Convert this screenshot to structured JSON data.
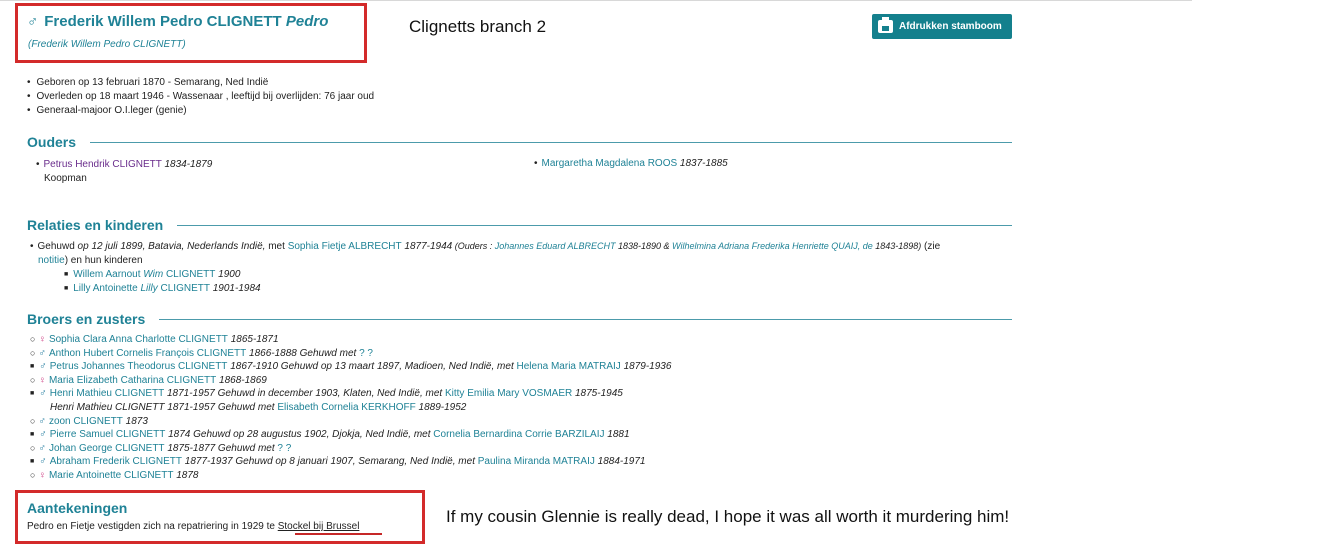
{
  "person": {
    "symbol": "♂",
    "name": "Frederik Willem Pedro CLIGNETT",
    "nickname": "Pedro",
    "alt_name": "(Frederik Willem Pedro CLIGNETT)"
  },
  "annotation_title": "Clignetts branch 2",
  "print_button_label": "Afdrukken stamboom",
  "facts": [
    "Geboren op 13 februari 1870 - Semarang, Ned Indië",
    "Overleden op 18 maart 1946 - Wassenaar , leeftijd bij overlijden: 76 jaar oud",
    "Generaal-majoor O.I.leger (genie)"
  ],
  "sections": {
    "parents": "Ouders",
    "relations": "Relaties en kinderen",
    "siblings": "Broers en zusters",
    "notes": "Aantekeningen"
  },
  "parents": {
    "father": {
      "name": "Petrus Hendrik CLIGNETT",
      "years": "1834-1879",
      "occupation": "Koopman"
    },
    "mother": {
      "name": "Margaretha Magdalena ROOS",
      "years": "1837-1885"
    }
  },
  "relation": {
    "prefix": "Gehuwd",
    "detail": " op 12 juli 1899, Batavia, Nederlands Indië,",
    "met": " met ",
    "spouse": "Sophia Fietje ALBRECHT",
    "spouse_years": " 1877-1944",
    "ouders_label": " (Ouders : ",
    "father": "Johannes Eduard ALBRECHT",
    "father_years": " 1838-1890 & ",
    "mother": "Wilhelmina Adriana Frederika Henriette QUAIJ, de",
    "mother_years": " 1843-1898)",
    "zie": " (zie",
    "note_link": "notitie",
    "kinderen": ") en hun kinderen",
    "children": [
      {
        "first": "Willem Aarnout ",
        "nick": "Wim",
        "last": " CLIGNETT",
        "years": " 1900"
      },
      {
        "first": "Lilly Antoinette ",
        "nick": "Lilly",
        "last": " CLIGNETT",
        "years": " 1901-1984"
      }
    ]
  },
  "siblings": [
    {
      "marker": "circ",
      "sex": "♀",
      "name": "Sophia Clara Anna Charlotte CLIGNETT",
      "info": " 1865-1871"
    },
    {
      "marker": "circ",
      "sex": "♂",
      "name": "Anthon Hubert Cornelis François CLIGNETT",
      "info": " 1866-1888 Gehuwd met ",
      "spouse": "? ?"
    },
    {
      "marker": "sq",
      "sex": "♂",
      "name": "Petrus Johannes Theodorus CLIGNETT",
      "info": " 1867-1910 Gehuwd op 13 maart 1897, Madioen, Ned Indië, met ",
      "spouse": "Helena Maria MATRAIJ",
      "spouse_years": " 1879-1936"
    },
    {
      "marker": "circ",
      "sex": "♀",
      "name": "Maria Elizabeth Catharina CLIGNETT",
      "info": " 1868-1869"
    },
    {
      "marker": "sq",
      "sex": "♂",
      "name": "Henri Mathieu CLIGNETT",
      "info": " 1871-1957 Gehuwd in december 1903, Klaten, Ned Indië, met ",
      "spouse": "Kitty Emilia Mary VOSMAER",
      "spouse_years": " 1875-1945"
    },
    {
      "marker": "cont",
      "prefix": "Henri Mathieu CLIGNETT 1871-1957 Gehuwd met ",
      "spouse": "Elisabeth Cornelia KERKHOFF",
      "spouse_years": " 1889-1952"
    },
    {
      "marker": "circ",
      "sex": "♂",
      "name": "zoon CLIGNETT",
      "info": " 1873"
    },
    {
      "marker": "sq",
      "sex": "♂",
      "name": "Pierre Samuel CLIGNETT",
      "info": " 1874 Gehuwd op 28 augustus 1902, Djokja, Ned Indië, met ",
      "spouse": "Cornelia Bernardina Corrie BARZILAIJ",
      "spouse_years": " 1881"
    },
    {
      "marker": "circ",
      "sex": "♂",
      "name": "Johan George CLIGNETT",
      "info": " 1875-1877 Gehuwd met ",
      "spouse": "? ?"
    },
    {
      "marker": "sq",
      "sex": "♂",
      "name": "Abraham Frederik CLIGNETT",
      "info": " 1877-1937 Gehuwd op 8 januari 1907, Semarang, Ned Indië, met ",
      "spouse": "Paulina Miranda MATRAIJ",
      "spouse_years": " 1884-1971"
    },
    {
      "marker": "circ",
      "sex": "♀",
      "name": "Marie Antoinette CLIGNETT",
      "info": " 1878"
    }
  ],
  "notes": {
    "text": "Pedro en Fietje vestigden zich na repatriering in 1929 te ",
    "place": "Stockel bij Brussel"
  },
  "annotation_comment": "If my cousin Glennie is really dead, I hope it was all worth it murdering him!",
  "colors": {
    "link": "#1f8296",
    "visited": "#6a2d8c",
    "button": "#14808d",
    "annotation_box": "#d32a2a"
  }
}
